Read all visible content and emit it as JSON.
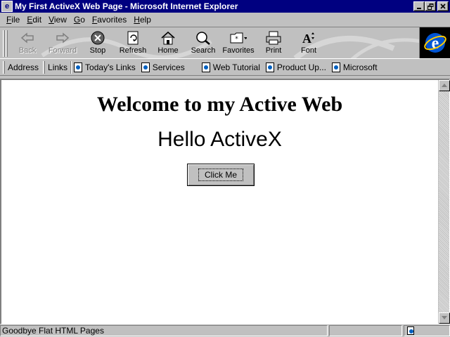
{
  "window": {
    "title": "My First ActiveX Web Page - Microsoft Internet Explorer",
    "app_icon": "ie-page-icon",
    "controls": [
      "minimize",
      "restore",
      "close"
    ]
  },
  "menu": {
    "items": [
      {
        "u": "F",
        "rest": "ile"
      },
      {
        "u": "E",
        "rest": "dit"
      },
      {
        "u": "V",
        "rest": "iew"
      },
      {
        "u": "G",
        "rest": "o"
      },
      {
        "u": "F",
        "rest": "avorites",
        "u_pos": "first"
      },
      {
        "u": "H",
        "rest": "elp"
      }
    ]
  },
  "toolbar": {
    "back": "Back",
    "forward": "Forward",
    "stop": "Stop",
    "refresh": "Refresh",
    "home": "Home",
    "search": "Search",
    "favorites": "Favorites",
    "print": "Print",
    "font": "Font"
  },
  "linksbar": {
    "address_label": "Address",
    "links_label": "Links",
    "links": [
      "Today's Links",
      "Services",
      "Web Tutorial",
      "Product Up...",
      "Microsoft"
    ]
  },
  "page": {
    "heading": "Welcome to my Active Web",
    "hello": "Hello ActiveX",
    "button_label": "Click Me"
  },
  "status": {
    "text": "Goodbye Flat HTML Pages"
  },
  "colors": {
    "titlebar": "#000080",
    "chrome": "#c0c0c0",
    "content_bg": "#ffffff"
  }
}
